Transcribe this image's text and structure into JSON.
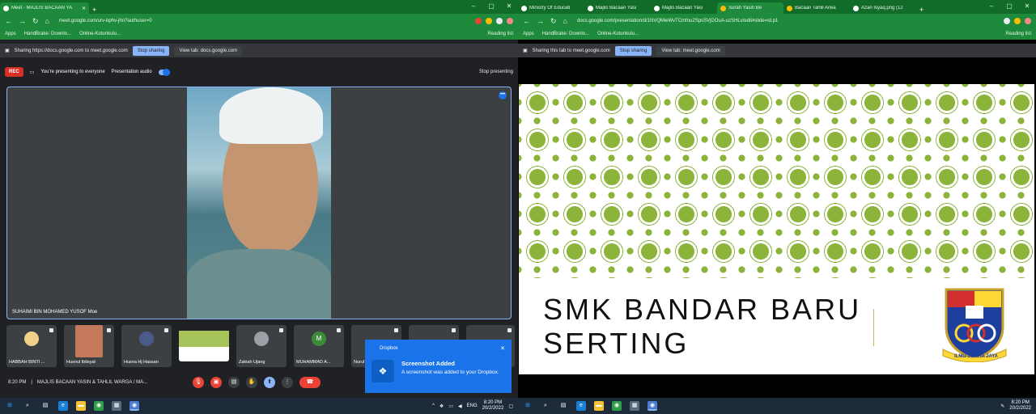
{
  "left": {
    "tabs": [
      {
        "label": "Meet - MAJLIS BACAAN YA"
      }
    ],
    "url": "meet.google.com/urv-bphv-jhn?authuser=0",
    "bookmarks": [
      "Apps",
      "HandBrake: Downlo...",
      "Online-Kotunkulu..."
    ],
    "reading_list": "Reading list",
    "share_text": "Sharing https://docs.google.com to meet.google.com",
    "stop_sharing": "Stop sharing",
    "view_tab": "View tab: docs.google.com",
    "rec": "REC",
    "presenting": "You're presenting to everyone",
    "pres_audio": "Presentation audio",
    "stop_presenting": "Stop presenting",
    "main_name": "SUHAIMI BIN MOHAMED YUSOF Moe",
    "participants": [
      {
        "name": "HABBAH BINTI ..."
      },
      {
        "name": "Husnul Ibtisyal"
      },
      {
        "name": "Husna Hj Hassan"
      },
      {
        "name": ""
      },
      {
        "name": "Zakiah Ujang"
      },
      {
        "name": "MUHAMMAD A..."
      },
      {
        "name": "Nurul"
      },
      {
        "name": ""
      },
      {
        "name": ""
      }
    ],
    "participant_initial": "M",
    "time": "8:20 PM",
    "meeting": "MAJLIS BACAAN YASIN & TAHLIL WARGA / MA...",
    "toast": {
      "app": "Dropbox",
      "title": "Screenshot Added",
      "body": "A screenshot was added to your Dropbox."
    },
    "taskbar": {
      "lang": "ENG",
      "time": "8:20 PM",
      "date": "20/2/2022"
    }
  },
  "right": {
    "tabs": [
      {
        "label": "Ministry Of Educati"
      },
      {
        "label": "Majlis Bacaan Yasi"
      },
      {
        "label": "Majlis Bacaan Yasi"
      },
      {
        "label": "Surah Yasin Be"
      },
      {
        "label": "Bacaan Tahlil Arwa"
      },
      {
        "label": "Azan Isyaq.png (12"
      }
    ],
    "url": "docs.google.com/presentation/d/1NVQMwWvTCmfnu2SpsSVjDOuA-uzSHLv/edit#slide=id.p1",
    "bookmarks": [
      "Apps",
      "HandBrake: Downlo...",
      "Online-Kotunkulu..."
    ],
    "reading_list": "Reading list",
    "share_text": "Sharing this tab to meet.google.com",
    "stop_sharing": "Stop sharing",
    "view_tab": "View tab: meet.google.com",
    "slide_title_1": "SMK BANDAR BARU",
    "slide_title_2": "SERTING",
    "crest_text": "ILMU USAHA JAYA",
    "taskbar": {
      "time": "8:20 PM",
      "date": "20/2/2022"
    }
  }
}
